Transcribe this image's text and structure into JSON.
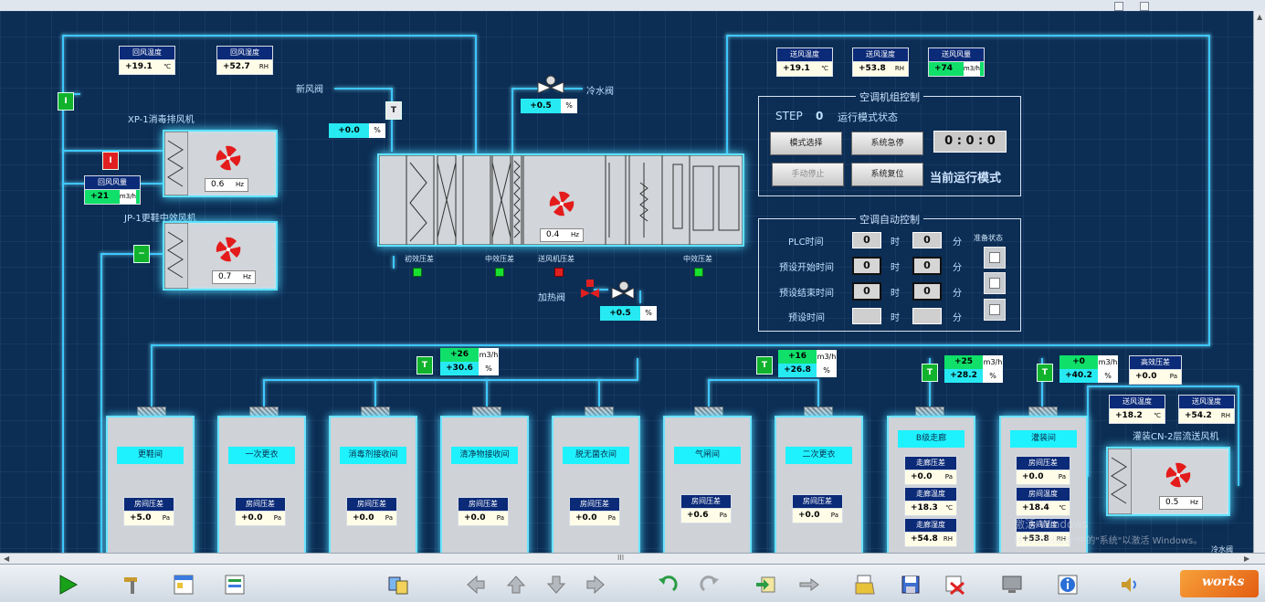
{
  "return_air": {
    "temp": {
      "label": "回风温度",
      "value": "+19.1",
      "unit": "℃"
    },
    "humidity": {
      "label": "回风湿度",
      "value": "+52.7",
      "unit": "RH"
    },
    "flow": {
      "label": "回风风量",
      "value": "+21",
      "unit": "m3/h"
    }
  },
  "supply_air": {
    "temp": {
      "label": "送风温度",
      "value": "+19.1",
      "unit": "℃"
    },
    "humidity": {
      "label": "送风湿度",
      "value": "+53.8",
      "unit": "RH"
    },
    "flow": {
      "label": "送风风量",
      "value": "+74",
      "unit": "m3/h"
    }
  },
  "fans": {
    "xp1": {
      "label": "XP-1消毒排风机",
      "hz": "0.6",
      "unit": "Hz"
    },
    "jp1": {
      "label": "JP-1更鞋中效风机",
      "hz": "0.7",
      "unit": "Hz"
    },
    "ahu": {
      "hz": "0.4",
      "unit": "Hz"
    },
    "cn2": {
      "label": "灌装CN-2层流送风机",
      "hz": "0.5",
      "unit": "Hz"
    }
  },
  "valves": {
    "fresh_air": {
      "label": "新风阀",
      "value": "+0.0",
      "unit": "%"
    },
    "chilled_water": {
      "label": "冷水阀",
      "value": "+0.5",
      "unit": "%"
    },
    "heating": {
      "label": "加热阀",
      "value": "+0.5",
      "unit": "%"
    }
  },
  "switch_labels": {
    "on": "I",
    "t": "T"
  },
  "filters": {
    "primary": "初效压差",
    "medium": "中效压差",
    "fan": "送风机压差",
    "medium2": "中效压差"
  },
  "ahu_control": {
    "title": "空调机组控制",
    "step_label": "STEP",
    "step_value": "0",
    "status": "运行模式状态",
    "btn_mode": "模式选择",
    "btn_estop": "系统急停",
    "btn_manual_stop": "手动停止",
    "btn_reset": "系统复位",
    "time_h": "0",
    "time_m": "0",
    "time_s": "0",
    "time_sep": ":",
    "mode_text": "当前运行模式"
  },
  "auto_control": {
    "title": "空调自动控制",
    "plc_time": "PLC时间",
    "preset_start": "预设开始时间",
    "preset_end": "预设结束时间",
    "preset_time": "预设时间",
    "hour": "时",
    "minute": "分",
    "plc_h": "0",
    "plc_m": "0",
    "start_h": "0",
    "start_m": "0",
    "end_h": "0",
    "end_m": "0",
    "side_label": "准备状态"
  },
  "branch_flows": [
    {
      "flow": "+26",
      "flow_unit": "m3/h",
      "humid": "+30.6",
      "humid_unit": "%"
    },
    {
      "flow": "+16",
      "flow_unit": "m3/h",
      "humid": "+26.8",
      "humid_unit": "%"
    },
    {
      "flow": "+25",
      "flow_unit": "m3/h",
      "humid": "+28.2",
      "humid_unit": "%"
    },
    {
      "flow": "+0",
      "flow_unit": "m3/h",
      "humid": "+40.2",
      "humid_unit": "%"
    }
  ],
  "hepa": {
    "label": "高效压差",
    "value": "+0.0",
    "unit": "Pa"
  },
  "cn2_supply": {
    "temp": {
      "label": "送风温度",
      "value": "+18.2",
      "unit": "℃"
    },
    "humidity": {
      "label": "送风湿度",
      "value": "+54.2",
      "unit": "RH"
    }
  },
  "rooms": [
    {
      "name": "更鞋间",
      "pressure_label": "房间压差",
      "pressure": "+5.0",
      "unit": "Pa"
    },
    {
      "name": "一次更衣",
      "pressure_label": "房间压差",
      "pressure": "+0.0",
      "unit": "Pa"
    },
    {
      "name": "消毒剂接收间",
      "pressure_label": "房间压差",
      "pressure": "+0.0",
      "unit": "Pa"
    },
    {
      "name": "清净物接收间",
      "pressure_label": "房间压差",
      "pressure": "+0.0",
      "unit": "Pa"
    },
    {
      "name": "脱无菌衣间",
      "pressure_label": "房间压差",
      "pressure": "+0.0",
      "unit": "Pa"
    },
    {
      "name": "气闸间",
      "pressure_label": "房间压差",
      "pressure": "+0.6",
      "unit": "Pa"
    },
    {
      "name": "二次更衣",
      "pressure_label": "房间压差",
      "pressure": "+0.0",
      "unit": "Pa"
    }
  ],
  "corridor": {
    "name": "B级走廊",
    "pressure": {
      "label": "走廊压差",
      "value": "+0.0",
      "unit": "Pa"
    },
    "temp": {
      "label": "走廊温度",
      "value": "+18.3",
      "unit": "℃"
    },
    "humidity": {
      "label": "走廊湿度",
      "value": "+54.8",
      "unit": "RH"
    }
  },
  "filling": {
    "name": "灌装间",
    "pressure": {
      "label": "房间压差",
      "value": "+0.0",
      "unit": "Pa"
    },
    "temp": {
      "label": "房间温度",
      "value": "+18.4",
      "unit": "℃"
    },
    "humidity": {
      "label": "房间湿度",
      "value": "+53.8",
      "unit": "RH"
    }
  },
  "watermark": {
    "line1": "激活 Windows",
    "line2": "转到\"控制面板\"中的\"系统\"以激活 Windows。"
  },
  "bottom_clip_label": "冷水阀",
  "scroll_grip": "III",
  "toolbar_logo": "works",
  "colors": {
    "background": "#0c2d54",
    "pipe": "#3ec6ff",
    "tag_header": "#0b2a78",
    "green": "#10e06a",
    "cyan": "#27e9f2",
    "red": "#e02020"
  },
  "toolbar_icons": [
    "play-icon",
    "tools-icon",
    "layout-icon",
    "window-icon",
    "transfer-icon",
    "arrow-left-icon",
    "arrow-up-icon",
    "arrow-down-icon",
    "arrow-right-icon",
    "undo-icon",
    "redo-icon",
    "import-icon",
    "export-icon",
    "open-folder-icon",
    "save-icon",
    "delete-icon",
    "monitor-icon",
    "info-icon",
    "audio-icon"
  ]
}
